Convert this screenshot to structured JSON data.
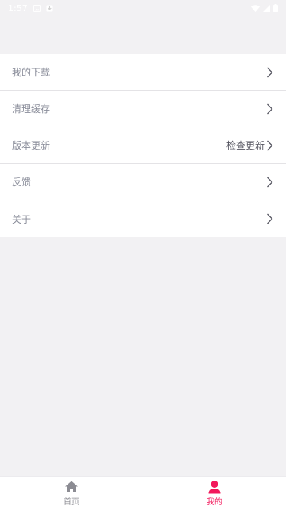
{
  "status_bar": {
    "time": "1:57",
    "icons": [
      "image-icon",
      "download-status-icon",
      "wifi-icon",
      "signal-icon",
      "battery-icon"
    ]
  },
  "menu": {
    "items": [
      {
        "label": "我的下载",
        "extra": ""
      },
      {
        "label": "清理缓存",
        "extra": ""
      },
      {
        "label": "版本更新",
        "extra": "检查更新"
      },
      {
        "label": "反馈",
        "extra": ""
      },
      {
        "label": "关于",
        "extra": ""
      }
    ]
  },
  "tabbar": {
    "tabs": [
      {
        "label": "首页",
        "icon": "home-icon",
        "active": false
      },
      {
        "label": "我的",
        "icon": "user-icon",
        "active": true
      }
    ],
    "active_color": "#f2185b",
    "inactive_color": "#8c8c93"
  }
}
